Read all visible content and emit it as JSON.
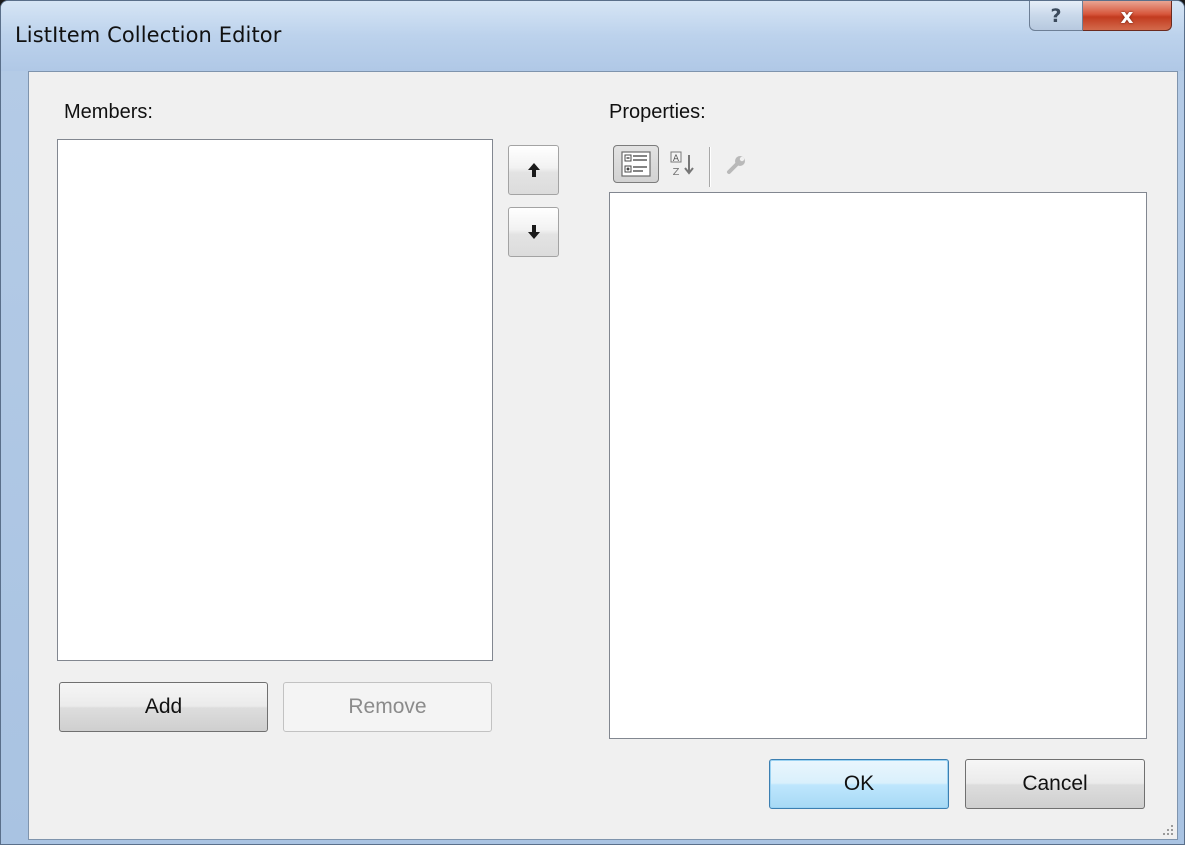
{
  "window": {
    "title": "ListItem Collection Editor",
    "help_label": "?",
    "close_label": "x"
  },
  "members": {
    "label": "Members:",
    "items": [],
    "move_up_symbol": "🡅",
    "move_down_symbol": "🡇",
    "add_label": "Add",
    "remove_label": "Remove",
    "remove_enabled": false
  },
  "properties": {
    "label": "Properties:",
    "toolbar": {
      "categorized_icon": "categorized-view-icon",
      "alphabetical_icon": "sort-alphabetical-icon",
      "property_pages_icon": "wrench-icon",
      "categorized_selected": true
    },
    "rows": []
  },
  "footer": {
    "ok_label": "OK",
    "cancel_label": "Cancel"
  },
  "colors": {
    "title_bar": "#bcd2ec",
    "client_bg": "#f0f0f0",
    "close_button": "#c7432a",
    "default_button_border": "#3c7fb1"
  }
}
